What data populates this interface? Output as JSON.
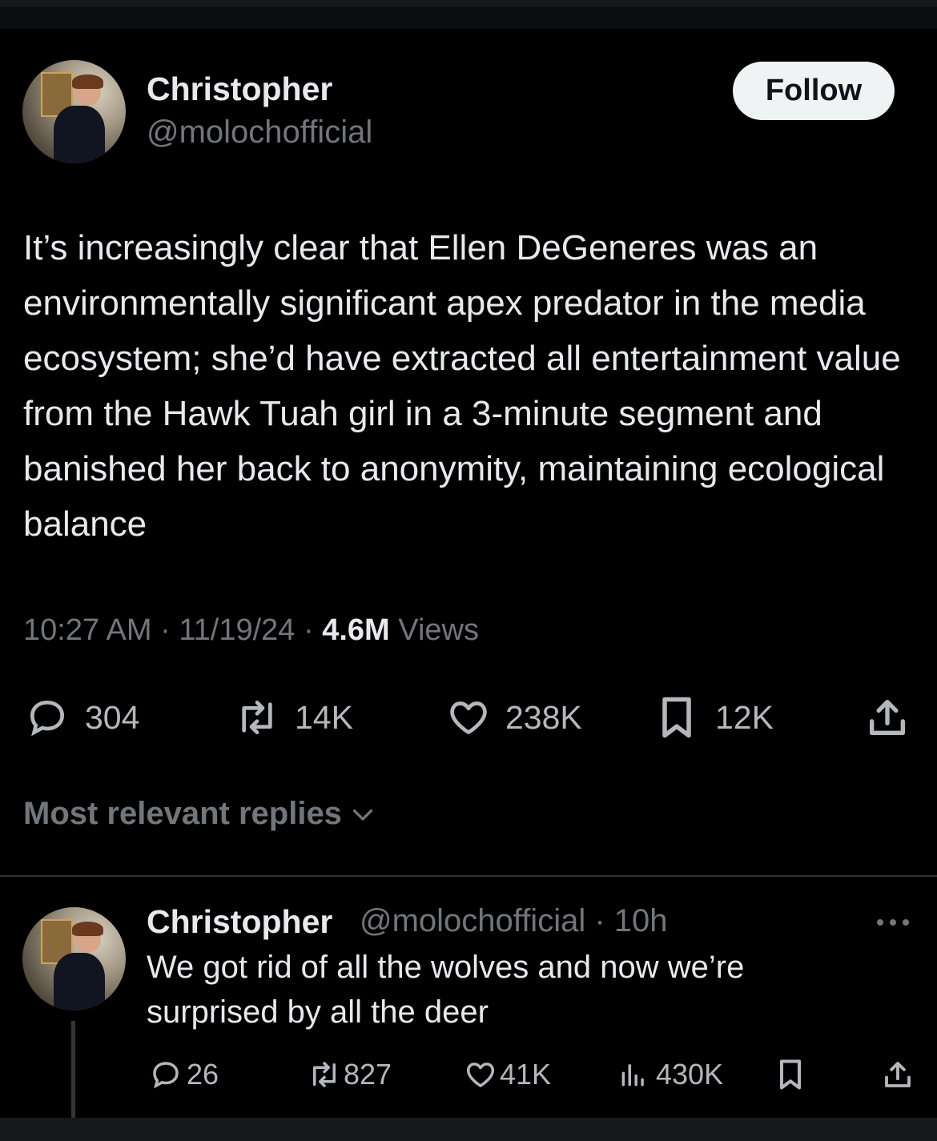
{
  "tweet": {
    "author": {
      "name": "Christopher",
      "handle": "@molochofficial"
    },
    "follow_label": "Follow",
    "text": "It’s increasingly clear that Ellen DeGeneres was an environmentally significant apex predator in the media ecosystem; she’d have extracted all entertainment value from the Hawk Tuah girl in a 3-minute segment and banished her back to anonymity, maintaining ecological balance",
    "time": "10:27 AM",
    "date": "11/19/24",
    "views_count": "4.6M",
    "views_label": "Views",
    "separator": "·",
    "actions": {
      "replies": "304",
      "reposts": "14K",
      "likes": "238K",
      "bookmarks": "12K"
    }
  },
  "replies_section": {
    "sort_label": "Most relevant replies"
  },
  "reply": {
    "author": {
      "name": "Christopher",
      "handle": "@molochofficial",
      "age": "10h"
    },
    "separator": "·",
    "text": "We got rid of all the wolves and now we’re surprised by all the deer",
    "actions": {
      "replies": "26",
      "reposts": "827",
      "likes": "41K",
      "views": "430K"
    }
  },
  "colors": {
    "background": "#000000",
    "text": "#e7e9ea",
    "muted": "#71767b",
    "button_bg": "#eff3f4"
  },
  "icons": [
    "reply-icon",
    "repost-icon",
    "like-icon",
    "bookmark-icon",
    "share-icon",
    "views-icon",
    "more-icon",
    "chevron-down-icon"
  ]
}
